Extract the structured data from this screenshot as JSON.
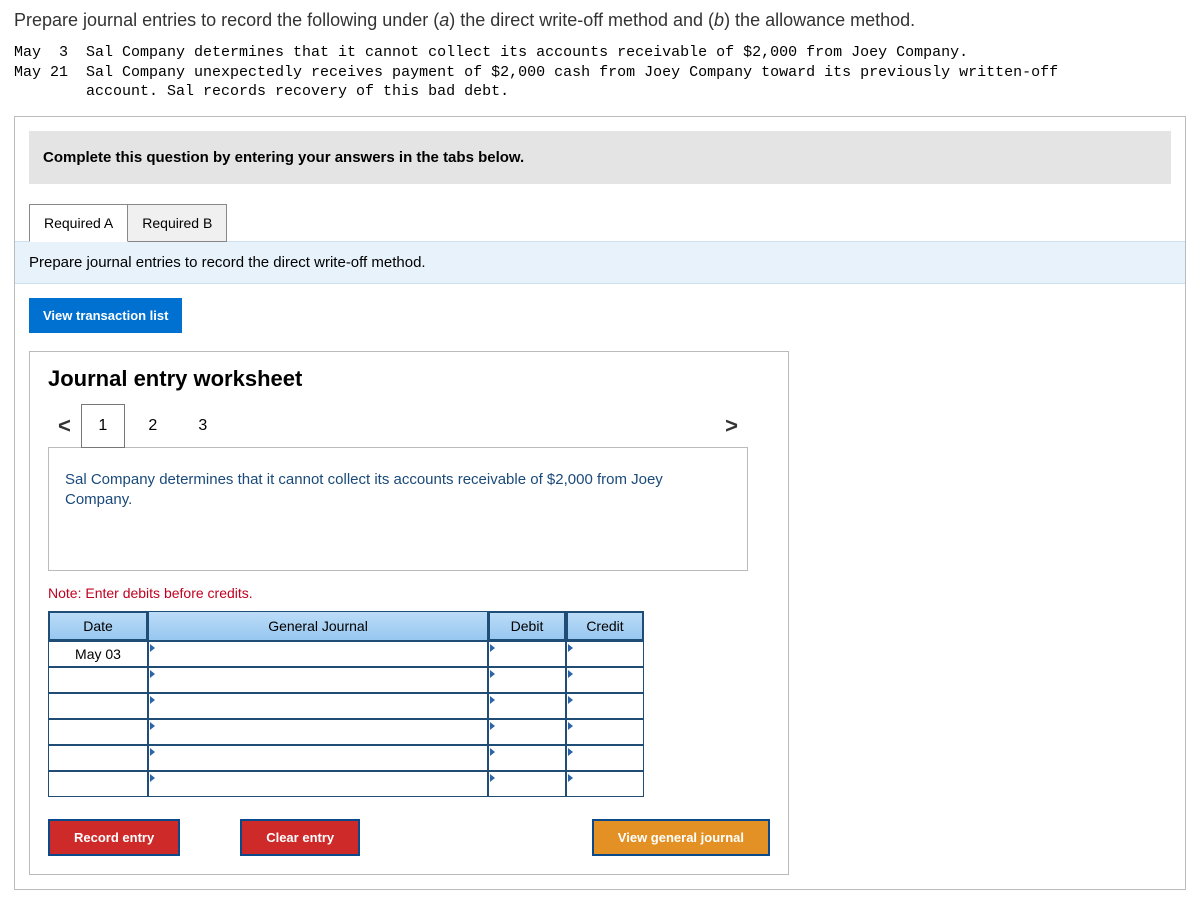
{
  "intro_pre": "Prepare journal entries to record the following under (",
  "intro_a": "a",
  "intro_mid": ") the direct write-off method and (",
  "intro_b": "b",
  "intro_post": ") the allowance method.",
  "mono": "May  3  Sal Company determines that it cannot collect its accounts receivable of $2,000 from Joey Company.\nMay 21  Sal Company unexpectedly receives payment of $2,000 cash from Joey Company toward its previously written-off\n        account. Sal records recovery of this bad debt.",
  "instruction": "Complete this question by entering your answers in the tabs below.",
  "tabs": {
    "a": "Required A",
    "b": "Required B"
  },
  "prompt": "Prepare journal entries to record the direct write-off method.",
  "view_list_btn": "View transaction list",
  "ws_title": "Journal entry worksheet",
  "nav": {
    "left": "<",
    "right": ">",
    "steps": [
      "1",
      "2",
      "3"
    ]
  },
  "ws_desc": "Sal Company determines that it cannot collect its accounts receivable of $2,000 from Joey Company.",
  "note": "Note: Enter debits before credits.",
  "headers": {
    "date": "Date",
    "gj": "General Journal",
    "debit": "Debit",
    "credit": "Credit"
  },
  "rows": [
    {
      "date": "May 03"
    },
    {
      "date": ""
    },
    {
      "date": ""
    },
    {
      "date": ""
    },
    {
      "date": ""
    },
    {
      "date": ""
    }
  ],
  "buttons": {
    "record": "Record entry",
    "clear": "Clear entry",
    "vgj": "View general journal"
  }
}
